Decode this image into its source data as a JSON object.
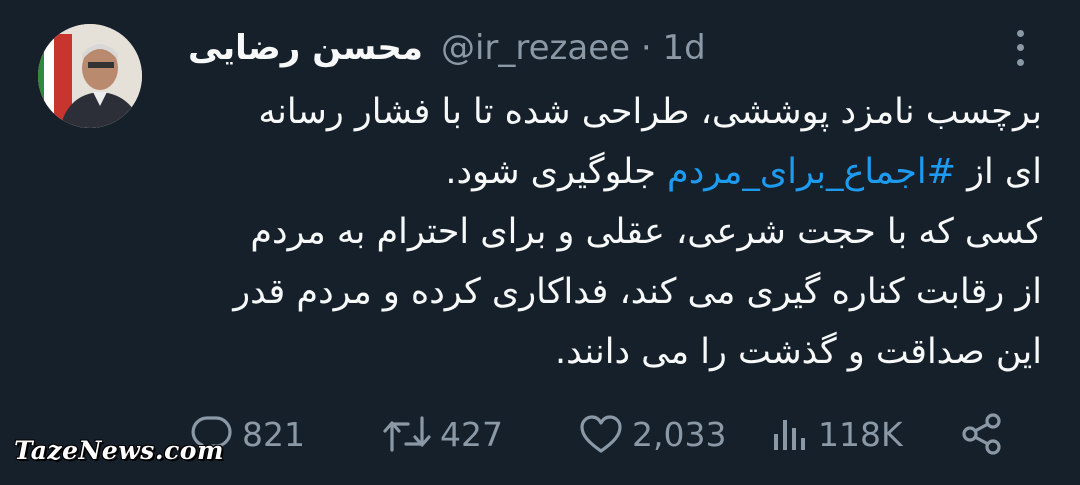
{
  "author": {
    "name": "محسن رضایی",
    "handle": "@ir_rezaee",
    "separator": "·",
    "time": "1d"
  },
  "tweet": {
    "line1": "برچسب نامزد پوششی، طراحی شده تا با فشار رسانه",
    "line2_before": "ای از ",
    "hashtag": "#اجماع_برای_مردم",
    "line2_after": " جلوگیری شود.",
    "line3": "کسی که با حجت شرعی، عقلی و برای احترام به مردم",
    "line4": "از رقابت کناره گیری می کند، فداکاری کرده و مردم قدر",
    "line5": "این صداقت و گذشت را می دانند."
  },
  "actions": {
    "replies": "821",
    "retweets": "427",
    "likes": "2,033",
    "views": "118K"
  },
  "icons": {
    "reply": "reply-icon",
    "retweet": "retweet-icon",
    "like": "heart-icon",
    "views": "views-icon",
    "share": "share-icon",
    "more": "more-icon"
  },
  "watermark": "TazeNews.com",
  "colors": {
    "background": "#15202b",
    "text": "#f7f9f9",
    "secondary": "#8b98a5",
    "accent": "#1d9bf0"
  }
}
